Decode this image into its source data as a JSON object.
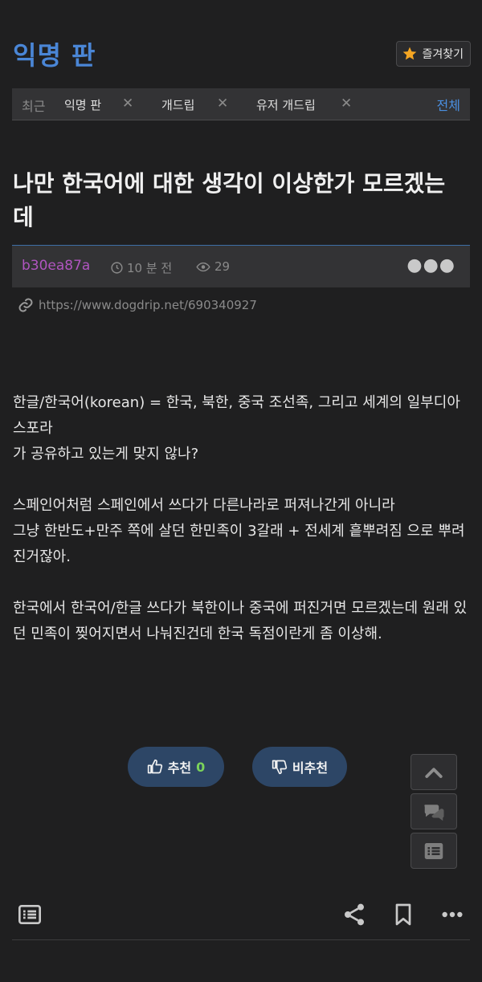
{
  "header": {
    "board_title": "익명 판",
    "favorites_label": "즐겨찾기"
  },
  "recent": {
    "label": "최근",
    "items": [
      {
        "label": "익명 판"
      },
      {
        "label": "개드립"
      },
      {
        "label": "유저 개드립"
      }
    ],
    "all_label": "전체"
  },
  "post": {
    "title": "나만 한국어에 대한 생각이 이상한가 모르겠는데",
    "author": "b30ea87a",
    "time": "10 분 전",
    "views": "29",
    "url": "https://www.dogdrip.net/690340927",
    "body": {
      "p1_l1": "한글/한국어(korean) = 한국, 북한, 중국 조선족, 그리고 세계의 일부디아스포라",
      "p1_l2": "가 공유하고 있는게 맞지 않나?",
      "p2_l1": "스페인어처럼 스페인에서 쓰다가 다른나라로 퍼져나간게 아니라",
      "p2_l2": "그냥 한반도+만주 쪽에 살던 한민족이 3갈래 + 전세계 흩뿌려짐 으로 뿌려진거잖아.",
      "p3_l1": "한국에서 한국어/한글 쓰다가 북한이나 중국에 퍼진거면 모르겠는데 원래 있던 민족이 찢어지면서 나눠진건데 한국 독점이란게 좀 이상해."
    }
  },
  "votes": {
    "up_label": "추천",
    "up_count": "0",
    "down_label": "비추천"
  },
  "colors": {
    "accent": "#4a86d6",
    "author": "#b055c0",
    "vote_bg": "#2d4666",
    "vote_count": "#7bd35a"
  },
  "icons": {
    "favorites": "star-icon",
    "time": "clock-icon",
    "views": "eye-icon",
    "link": "link-icon",
    "up": "thumbs-up-icon",
    "down": "thumbs-down-icon",
    "scroll_top": "chevron-up-icon",
    "comments": "comments-icon",
    "list": "list-icon",
    "share": "share-icon",
    "bookmark": "bookmark-icon",
    "more": "more-icon"
  }
}
